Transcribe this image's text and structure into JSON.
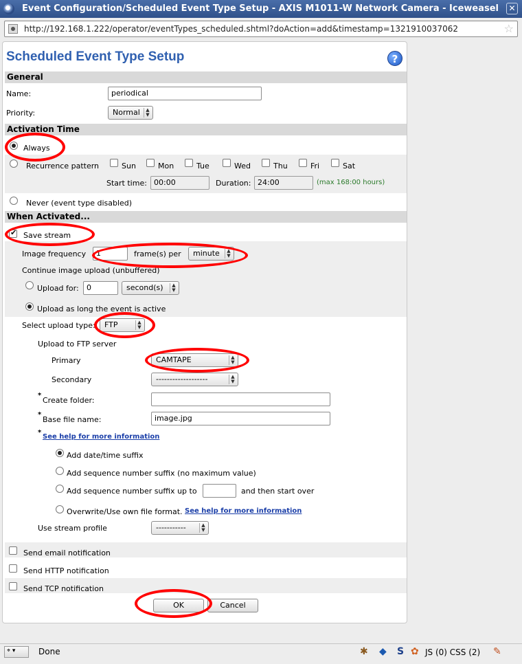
{
  "window": {
    "title": "Event Configuration/Scheduled Event Type Setup - AXIS M1011-W Network Camera - Iceweasel",
    "close_glyph": "✕"
  },
  "urlbar": {
    "url": "http://192.168.1.222/operator/eventTypes_scheduled.shtml?doAction=add&timestamp=1321910037062",
    "star_glyph": "☆"
  },
  "page": {
    "title": "Scheduled Event Type Setup",
    "help_glyph": "?"
  },
  "general": {
    "header": "General",
    "name_label": "Name:",
    "name_value": "periodical",
    "priority_label": "Priority:",
    "priority_value": "Normal"
  },
  "activation": {
    "header": "Activation Time",
    "always_label": "Always",
    "recurrence_label": "Recurrence pattern",
    "days": [
      "Sun",
      "Mon",
      "Tue",
      "Wed",
      "Thu",
      "Fri",
      "Sat"
    ],
    "start_time_label": "Start time:",
    "start_time_value": "00:00",
    "duration_label": "Duration:",
    "duration_value": "24:00",
    "duration_hint": "(max 168:00 hours)",
    "never_label": "Never (event type disabled)"
  },
  "when_activated": {
    "header": "When Activated...",
    "save_stream_label": "Save stream",
    "image_frequency_label": "Image frequency",
    "frames_value": "1",
    "frames_per_label": "frame(s) per",
    "unit_value": "minute",
    "continue_label": "Continue image upload (unbuffered)",
    "upload_for_label": "Upload for:",
    "upload_for_value": "0",
    "upload_for_unit": "second(s)",
    "upload_active_label": "Upload as long the event is active",
    "upload_type_label": "Select upload type:",
    "upload_type_value": "FTP",
    "ftp_server_label": "Upload to FTP server",
    "primary_label": "Primary",
    "primary_value": "CAMTAPE",
    "secondary_label": "Secondary",
    "secondary_value": "-------------------",
    "star": "*",
    "create_folder_label": "Create folder:",
    "create_folder_value": "",
    "base_file_label": "Base file name:",
    "base_file_value": "image.jpg",
    "help_link": "See help for more information",
    "suffix_datetime": "Add date/time suffix",
    "suffix_sequence": "Add sequence number suffix (no maximum value)",
    "suffix_upto": "Add sequence number suffix up to",
    "suffix_upto_value": "",
    "suffix_upto_after": "and then start over",
    "overwrite_label": "Overwrite/Use own file format.",
    "overwrite_link": "See help for more information",
    "stream_profile_label": "Use stream profile",
    "stream_profile_value": "-----------",
    "email_label": "Send email notification",
    "http_label": "Send HTTP notification",
    "tcp_label": "Send TCP notification"
  },
  "buttons": {
    "ok": "OK",
    "cancel": "Cancel"
  },
  "statusbar": {
    "status": "Done",
    "counters": "JS (0) CSS (2)"
  }
}
